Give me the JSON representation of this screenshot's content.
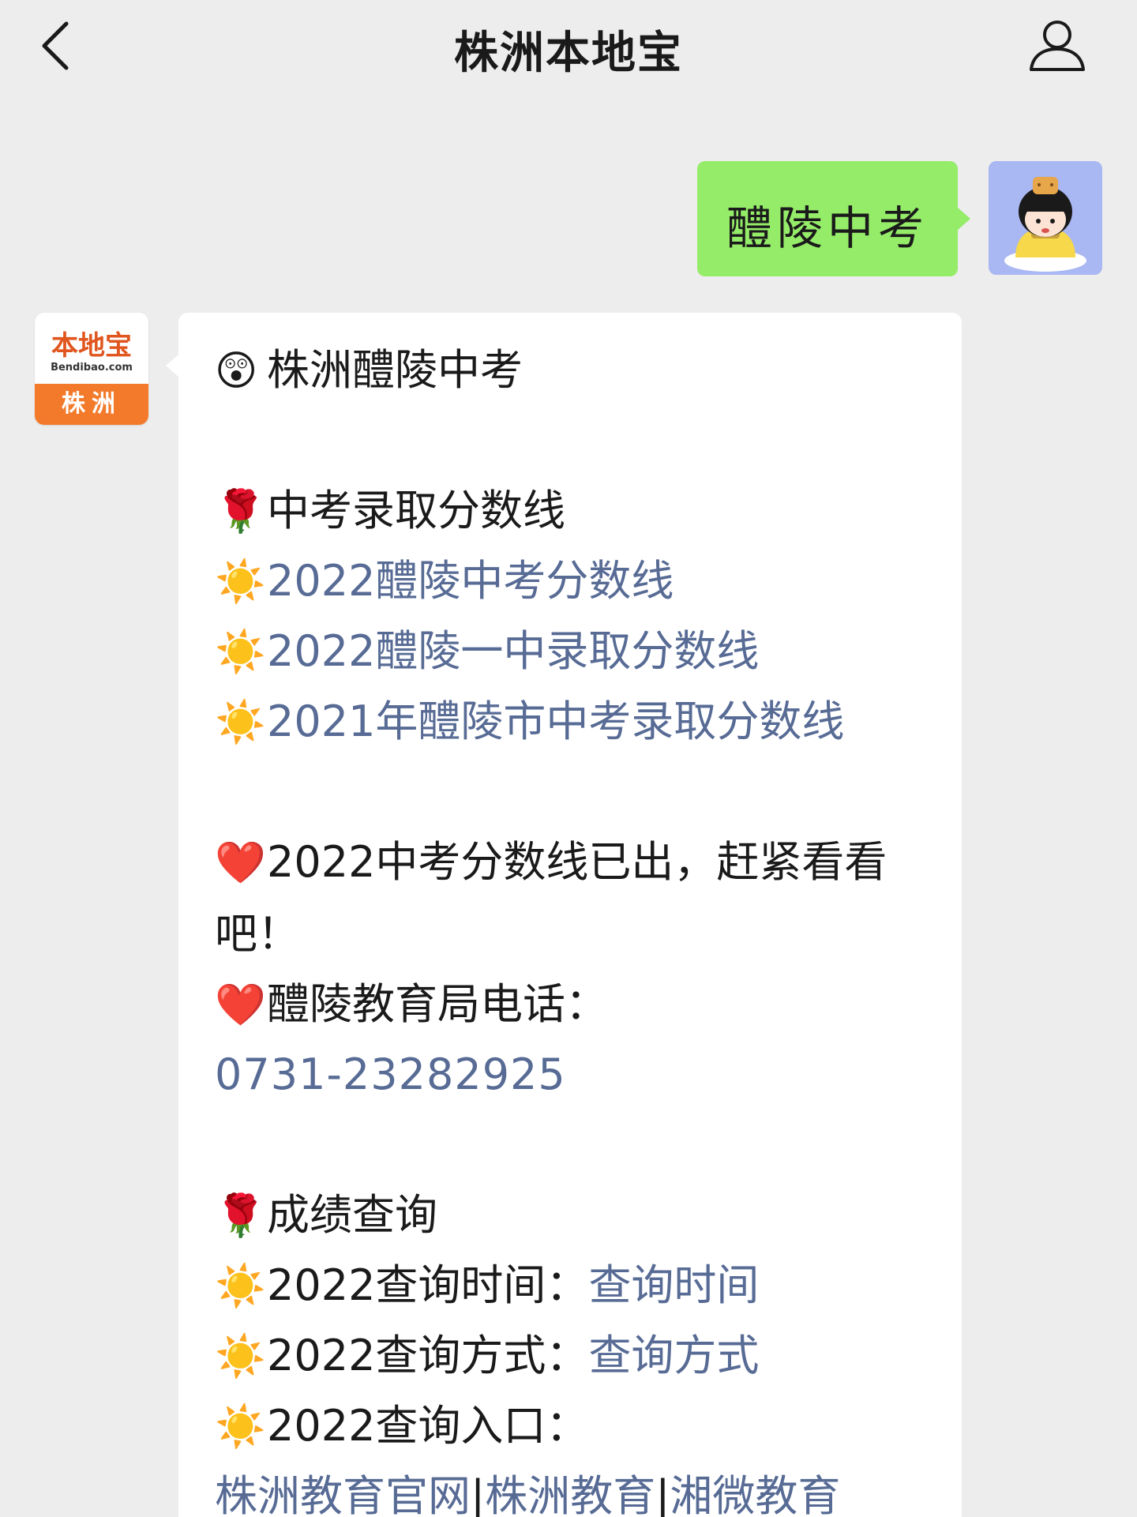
{
  "header": {
    "title": "株洲本地宝"
  },
  "outgoing": {
    "text": "醴陵中考"
  },
  "account": {
    "logo_top": "本地宝",
    "logo_sub": "Bendibao.com",
    "logo_city": "株洲"
  },
  "message": {
    "title_emoji": "😲",
    "title": "株洲醴陵中考",
    "section1": {
      "emoji": "🌹",
      "heading": "中考录取分数线",
      "links": [
        {
          "emoji": "☀️",
          "text": "2022醴陵中考分数线"
        },
        {
          "emoji": "☀️",
          "text": "2022醴陵一中录取分数线"
        },
        {
          "emoji": "☀️",
          "text": "2021年醴陵市中考录取分数线"
        }
      ]
    },
    "notice": {
      "emoji": "❤️",
      "text": "2022中考分数线已出，赶紧看看吧！"
    },
    "phone_info": {
      "emoji": "❤️",
      "label": "醴陵教育局电话：",
      "number": "0731-23282925"
    },
    "section2": {
      "emoji": "🌹",
      "heading": "成绩查询",
      "items": [
        {
          "emoji": "☀️",
          "label": "2022查询时间：",
          "link": "查询时间"
        },
        {
          "emoji": "☀️",
          "label": "2022查询方式：",
          "link": "查询方式"
        },
        {
          "emoji": "☀️",
          "label": "2022查询入口：",
          "link": ""
        }
      ],
      "portal_links": [
        "株洲教育官网",
        "株洲教育",
        "湘微教育"
      ],
      "portal_separator": "|"
    }
  },
  "colors": {
    "background": "#ededed",
    "outgoing_bubble": "#95ec69",
    "incoming_bubble": "#ffffff",
    "link": "#576b95",
    "logo_orange": "#f27a2a"
  },
  "icons": {
    "back": "chevron-left-icon",
    "profile": "person-icon"
  }
}
